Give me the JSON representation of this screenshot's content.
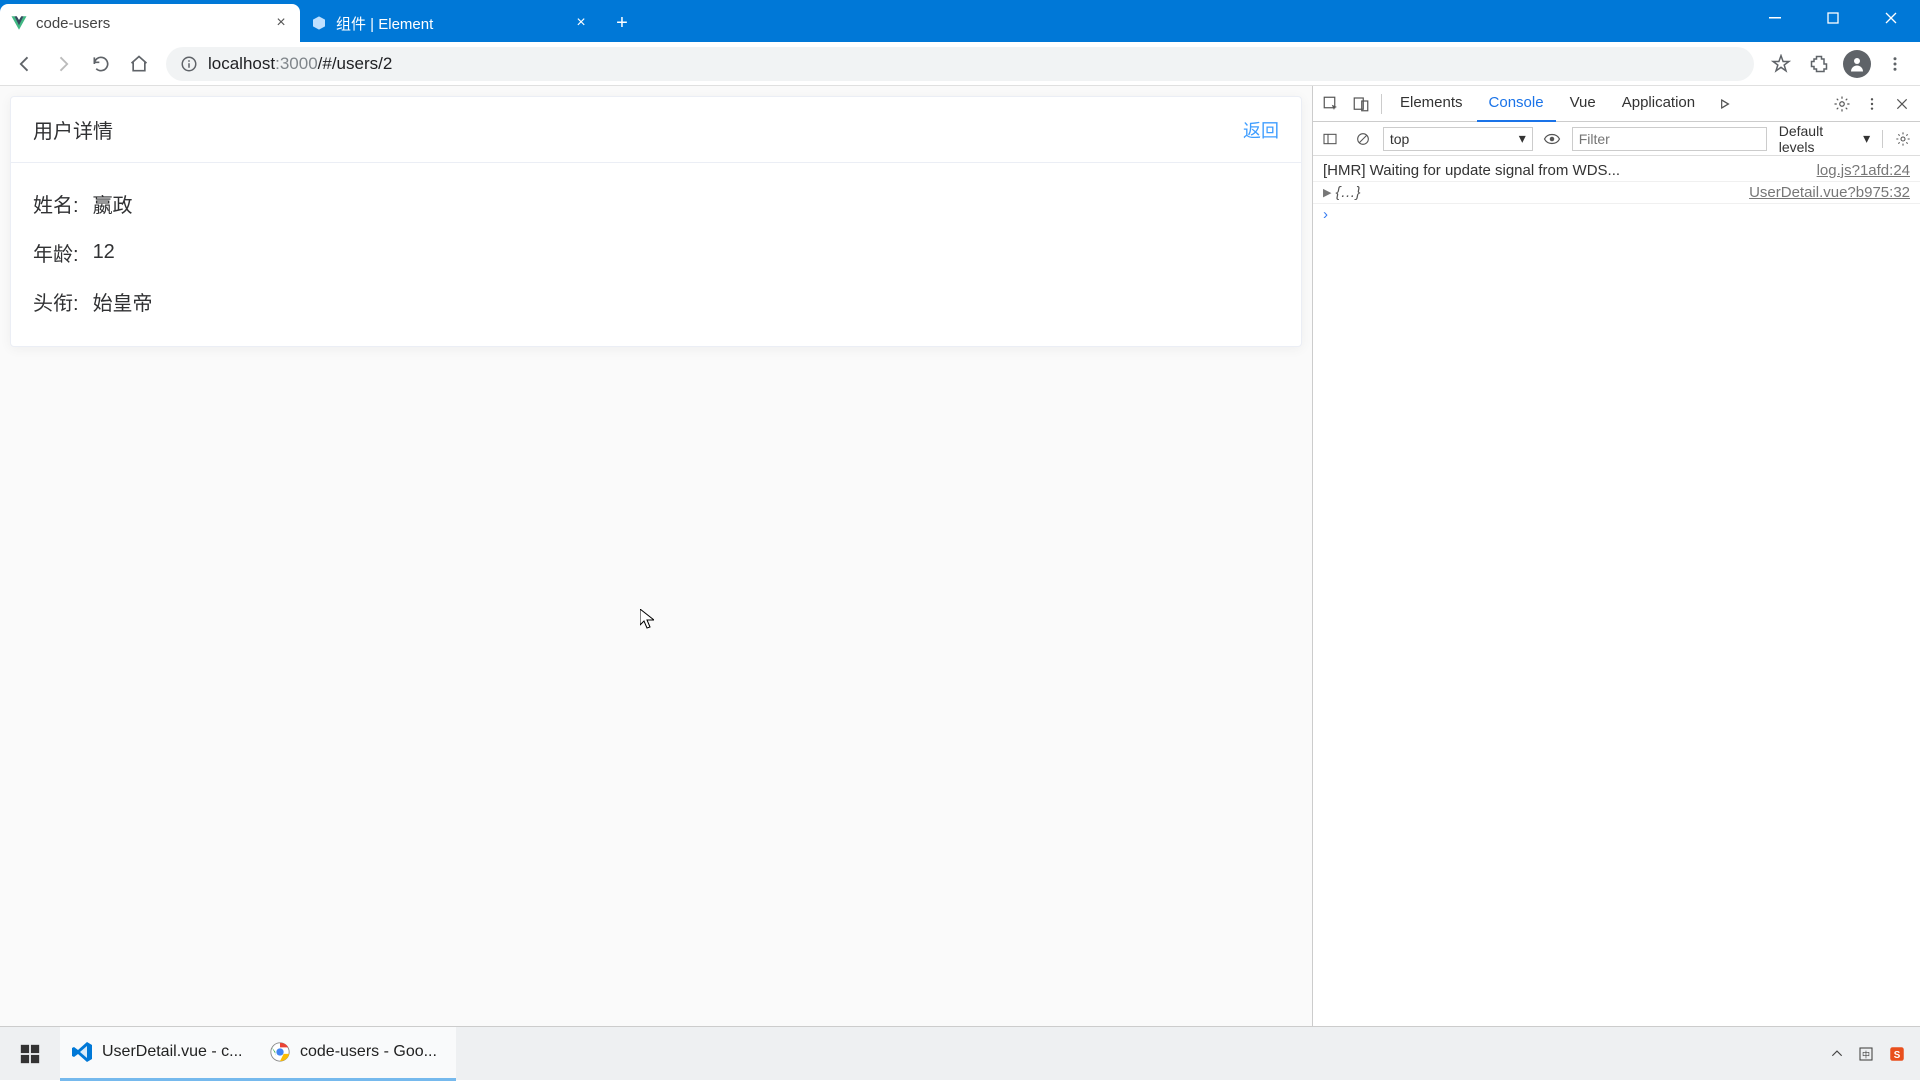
{
  "browser": {
    "tabs": [
      {
        "title": "code-users",
        "favicon": "vue"
      },
      {
        "title": "组件 | Element",
        "favicon": "element"
      }
    ],
    "url_host": "localhost",
    "url_port": ":3000",
    "url_path": "/#/users/2"
  },
  "page": {
    "card_title": "用户详情",
    "back_label": "返回",
    "fields": {
      "name_label": "姓名:",
      "name_value": "嬴政",
      "age_label": "年龄:",
      "age_value": "12",
      "title_label": "头衔:",
      "title_value": "始皇帝"
    }
  },
  "devtools": {
    "tabs": {
      "elements": "Elements",
      "console": "Console",
      "vue": "Vue",
      "application": "Application"
    },
    "toolbar": {
      "context": "top",
      "filter_placeholder": "Filter",
      "levels": "Default levels"
    },
    "log1_msg": "[HMR] Waiting for update signal from WDS...",
    "log1_src": "log.js?1afd:24",
    "log2_obj": "{…}",
    "log2_src": "UserDetail.vue?b975:32"
  },
  "taskbar": {
    "items": [
      {
        "label": "UserDetail.vue - c...",
        "icon": "vscode"
      },
      {
        "label": "code-users - Goo...",
        "icon": "chrome"
      }
    ]
  }
}
